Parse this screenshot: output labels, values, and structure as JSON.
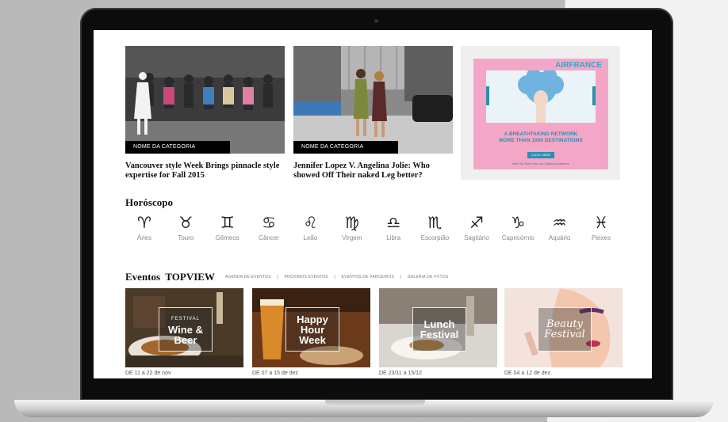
{
  "articles": [
    {
      "category": "NOME DA CATEGORIA",
      "title": "Vancouver style Week Brings pinnacle style expertise for Fall 2015"
    },
    {
      "category": "NOME DA CATEGORIA",
      "title": "Jennifer Lopez V. Angelina Jolie: Who showed Off Their naked Leg better?"
    }
  ],
  "ad": {
    "brand": "AIRFRANCE",
    "tagline_1": "A BREATHTAKING NETWORK",
    "tagline_2": "MORE THAN 1000 DESTINATIONS",
    "button": "CLICK HERE",
    "small_print": "with SkyTeam and our Skyteam partners"
  },
  "horoscope": {
    "title": "Horóscopo",
    "signs": [
      {
        "glyph": "♈",
        "name": "Áries"
      },
      {
        "glyph": "♉",
        "name": "Touro"
      },
      {
        "glyph": "♊",
        "name": "Gêmeos"
      },
      {
        "glyph": "♋",
        "name": "Câncer"
      },
      {
        "glyph": "♌",
        "name": "Leão"
      },
      {
        "glyph": "♍",
        "name": "Virgem"
      },
      {
        "glyph": "♎",
        "name": "Libra"
      },
      {
        "glyph": "♏",
        "name": "Escorpião"
      },
      {
        "glyph": "♐",
        "name": "Sagitário"
      },
      {
        "glyph": "♑",
        "name": "Capricórnio"
      },
      {
        "glyph": "♒",
        "name": "Aquário"
      },
      {
        "glyph": "♓",
        "name": "Peixes"
      }
    ]
  },
  "events": {
    "title": "Eventos  TOPVIEW",
    "tabs": [
      "AGENDA DE EVENTOS",
      "|",
      "PRÓXIMOS EVENTOS",
      "|",
      "EVENTOS DE PARCEIROS",
      "|",
      "GALERIA DE FOTOS"
    ],
    "cards": [
      {
        "label_small": "FESTIVAL",
        "label": "Wine & Beer",
        "date": "DE 11 a 22 de nov"
      },
      {
        "label_small": "",
        "label": "Happy Hour Week",
        "date": "DE 07 a 15 de dez"
      },
      {
        "label_small": "",
        "label": "Lunch Festival",
        "date": "DE 23/11 a 15/12"
      },
      {
        "label_small": "",
        "label": "Beauty Festival",
        "date": "DE 04 a 12 de dez"
      }
    ]
  }
}
